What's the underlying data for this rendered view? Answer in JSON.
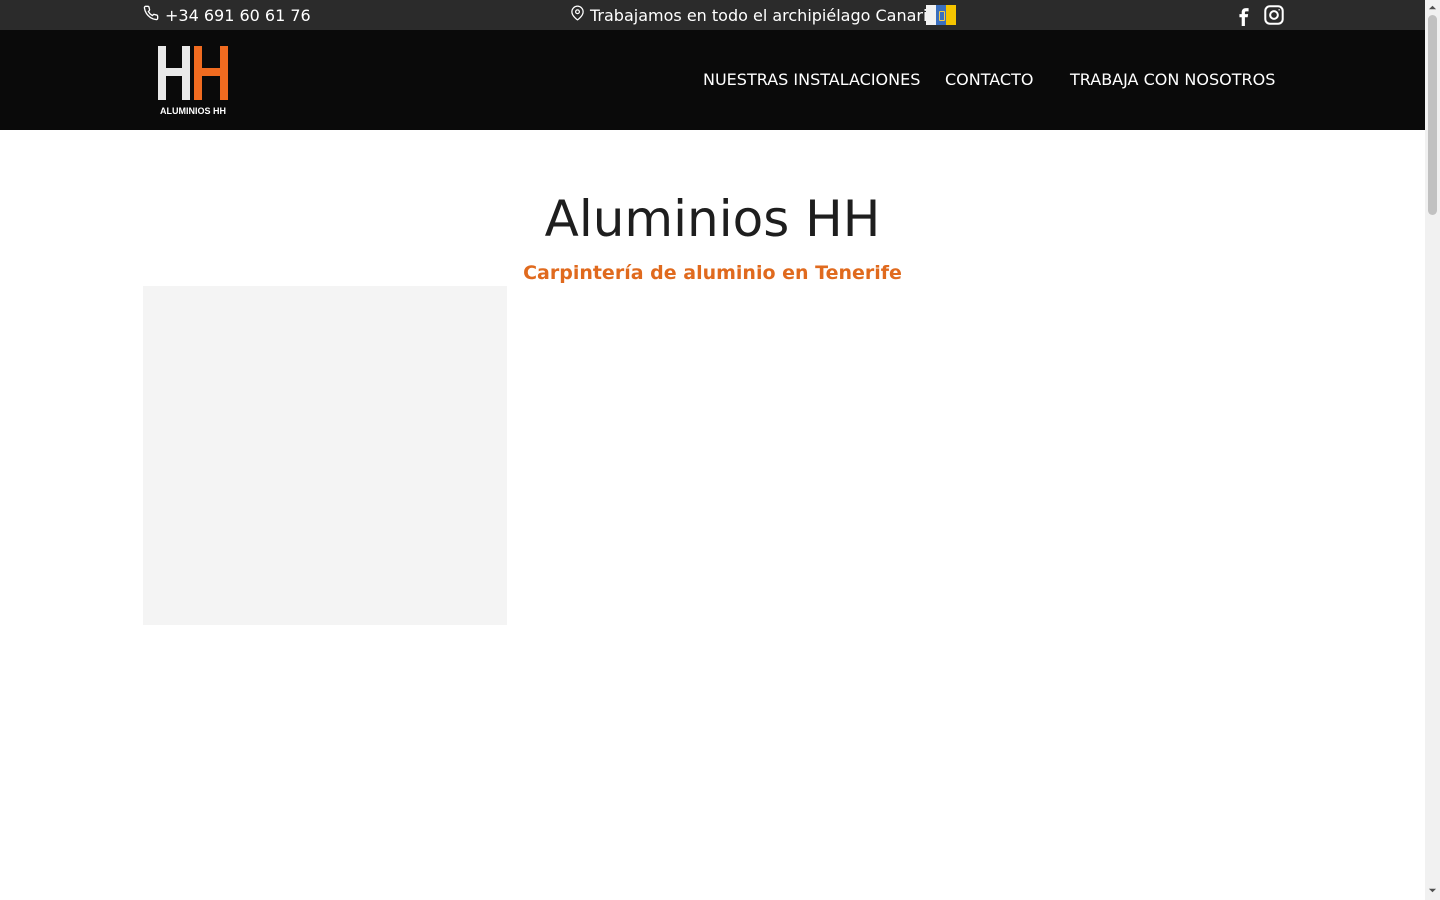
{
  "topbar": {
    "phone": "+34 691 60 61 76",
    "location": "Trabajamos en todo el archipiélago Canario",
    "flag_colors": [
      "#f2f2f2",
      "#3a6fbf",
      "#f5c400"
    ],
    "icons": {
      "phone": "phone-icon",
      "location": "map-pin-icon",
      "facebook": "facebook-icon",
      "instagram": "instagram-icon"
    }
  },
  "header": {
    "logo_text": "ALUMINIOS HH",
    "nav": [
      "NUESTRAS INSTALACIONES",
      "CONTACTO",
      "TRABAJA CON NOSOTROS"
    ]
  },
  "hero": {
    "title": "Aluminios HH",
    "subtitle": "Carpintería de aluminio en Tenerife"
  },
  "colors": {
    "accent": "#e06a1e",
    "topbar_bg": "#2b2b2b",
    "header_bg": "#0a0a0a",
    "placeholder_bg": "#f4f4f4"
  }
}
